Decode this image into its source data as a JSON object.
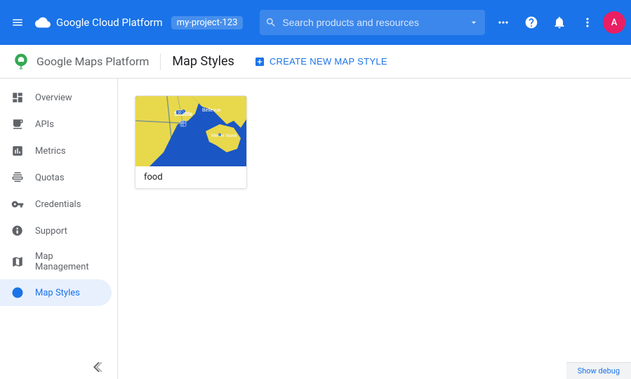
{
  "topbar": {
    "product_name": "Google Cloud Platform",
    "account_name": "my-project-123",
    "search_placeholder": "Search products and resources",
    "menu_icon": "menu-icon",
    "grid_icon": "apps-icon",
    "help_icon": "help-icon",
    "notification_icon": "notification-icon",
    "more_icon": "more-icon"
  },
  "secondbar": {
    "app_name": "Google Maps Platform",
    "page_title": "Map Styles",
    "create_btn_label": "CREATE NEW MAP STYLE"
  },
  "sidebar": {
    "items": [
      {
        "id": "overview",
        "label": "Overview",
        "icon": "overview-icon"
      },
      {
        "id": "apis",
        "label": "APIs",
        "icon": "apis-icon"
      },
      {
        "id": "metrics",
        "label": "Metrics",
        "icon": "metrics-icon"
      },
      {
        "id": "quotas",
        "label": "Quotas",
        "icon": "quotas-icon"
      },
      {
        "id": "credentials",
        "label": "Credentials",
        "icon": "credentials-icon"
      },
      {
        "id": "support",
        "label": "Support",
        "icon": "support-icon"
      },
      {
        "id": "map-management",
        "label": "Map Management",
        "icon": "map-management-icon"
      },
      {
        "id": "map-styles",
        "label": "Map Styles",
        "icon": "map-styles-icon",
        "active": true
      }
    ],
    "collapse_label": "Collapse"
  },
  "main": {
    "map_card": {
      "name": "food",
      "thumbnail_alt": "Seattle map style thumbnail"
    }
  },
  "bottombar": {
    "debug_label": "Show debug"
  }
}
